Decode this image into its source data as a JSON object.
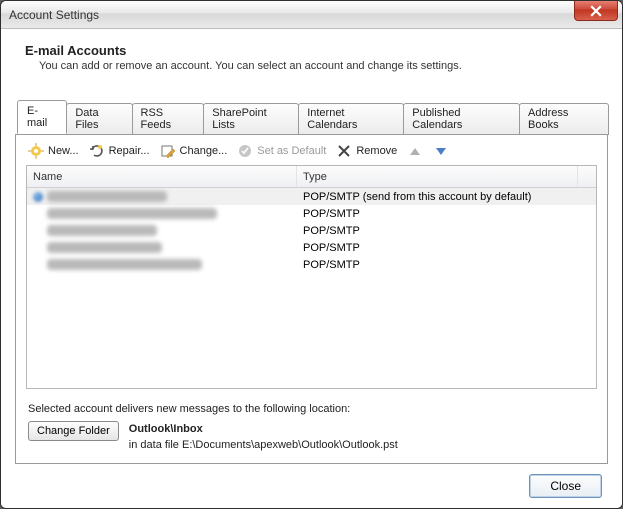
{
  "window": {
    "title": "Account Settings"
  },
  "header": {
    "title": "E-mail Accounts",
    "description": "You can add or remove an account. You can select an account and change its settings."
  },
  "tabs": [
    {
      "label": "E-mail",
      "active": true
    },
    {
      "label": "Data Files"
    },
    {
      "label": "RSS Feeds"
    },
    {
      "label": "SharePoint Lists"
    },
    {
      "label": "Internet Calendars"
    },
    {
      "label": "Published Calendars"
    },
    {
      "label": "Address Books"
    }
  ],
  "toolbar": {
    "new": "New...",
    "repair": "Repair...",
    "change": "Change...",
    "set_default": "Set as Default",
    "remove": "Remove"
  },
  "list": {
    "columns": {
      "name": "Name",
      "type": "Type"
    },
    "rows": [
      {
        "type": "POP/SMTP (send from this account by default)",
        "selected": true,
        "has_icon": true,
        "blur_width": 120
      },
      {
        "type": "POP/SMTP",
        "blur_width": 170
      },
      {
        "type": "POP/SMTP",
        "blur_width": 110
      },
      {
        "type": "POP/SMTP",
        "blur_width": 115
      },
      {
        "type": "POP/SMTP",
        "blur_width": 155
      }
    ]
  },
  "delivery": {
    "label": "Selected account delivers new messages to the following location:",
    "change_folder": "Change Folder",
    "folder_bold": "Outlook\\Inbox",
    "data_file_line": "in data file E:\\Documents\\apexweb\\Outlook\\Outlook.pst"
  },
  "footer": {
    "close": "Close"
  }
}
